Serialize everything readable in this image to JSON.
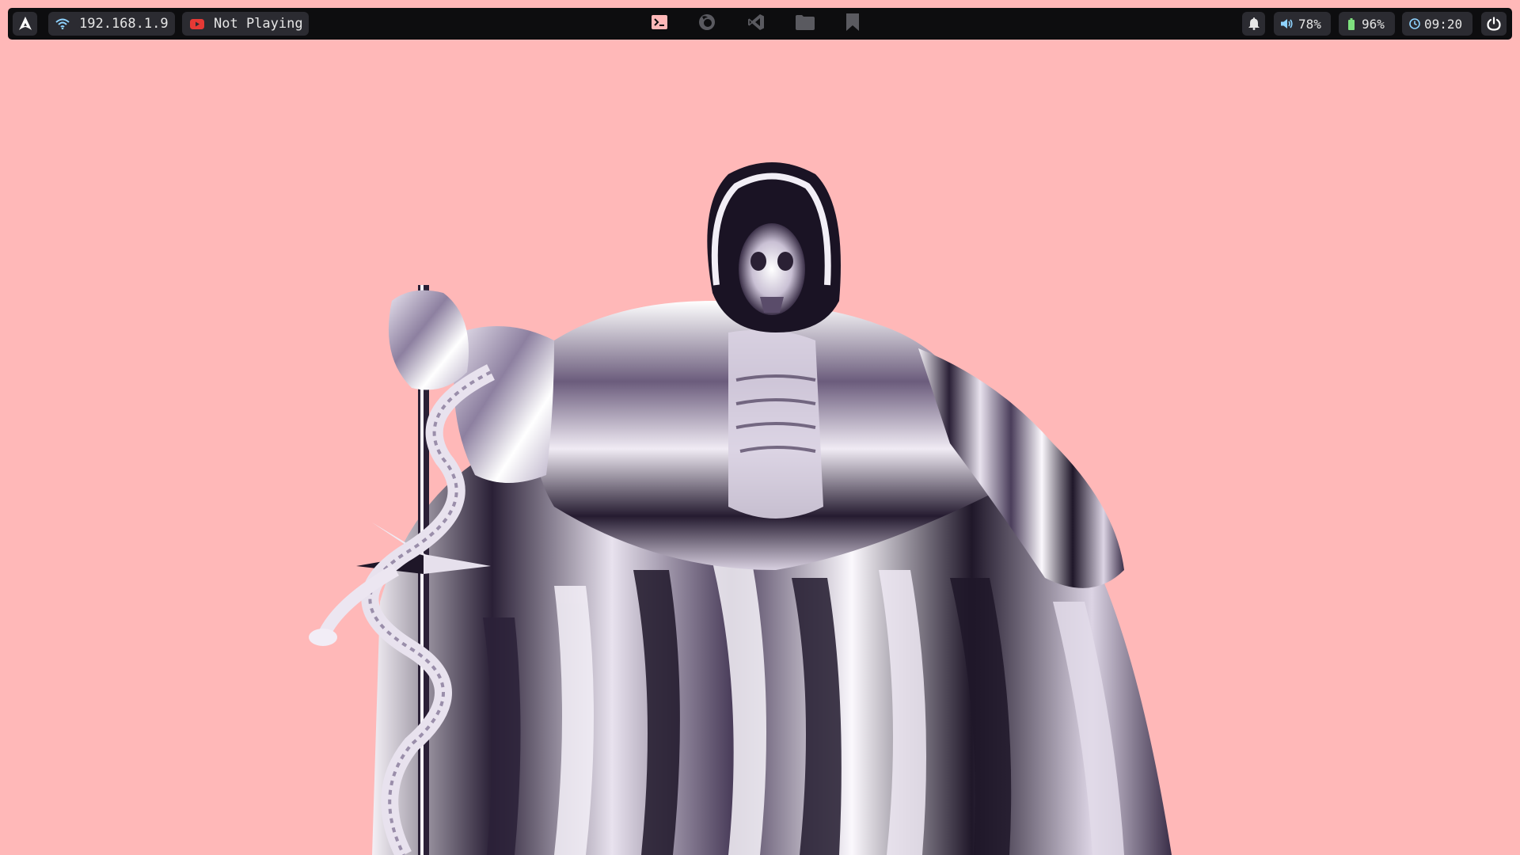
{
  "taskbar": {
    "launcher_icon": "arch-logo-icon",
    "network": {
      "icon": "wifi-icon",
      "label": "192.168.1.9",
      "icon_color": "#8fd3ff"
    },
    "media": {
      "icon": "youtube-icon",
      "label": "Not Playing",
      "icon_color": "#e53935"
    },
    "apps": [
      {
        "name": "terminal",
        "icon": "terminal-icon",
        "color": "#ffb8b8"
      },
      {
        "name": "firefox",
        "icon": "firefox-icon",
        "color": "#5a5a60"
      },
      {
        "name": "vscode",
        "icon": "vscode-icon",
        "color": "#5a5a60"
      },
      {
        "name": "files",
        "icon": "folder-icon",
        "color": "#5a5a60"
      },
      {
        "name": "bookmark",
        "icon": "bookmark-icon",
        "color": "#5a5a60"
      }
    ],
    "notifications": {
      "icon": "bell-icon"
    },
    "volume": {
      "icon": "speaker-icon",
      "label": "78%",
      "icon_color": "#8fd3ff"
    },
    "battery": {
      "icon": "battery-icon",
      "label": "96%",
      "icon_color": "#7ee07e"
    },
    "clock": {
      "icon": "clock-icon",
      "label": "09:20",
      "icon_color": "#8fd3ff"
    },
    "power": {
      "icon": "power-icon"
    }
  },
  "wallpaper": {
    "description_icon": "chrome-reaper-wallpaper",
    "background_color": "#ffb8b8"
  }
}
